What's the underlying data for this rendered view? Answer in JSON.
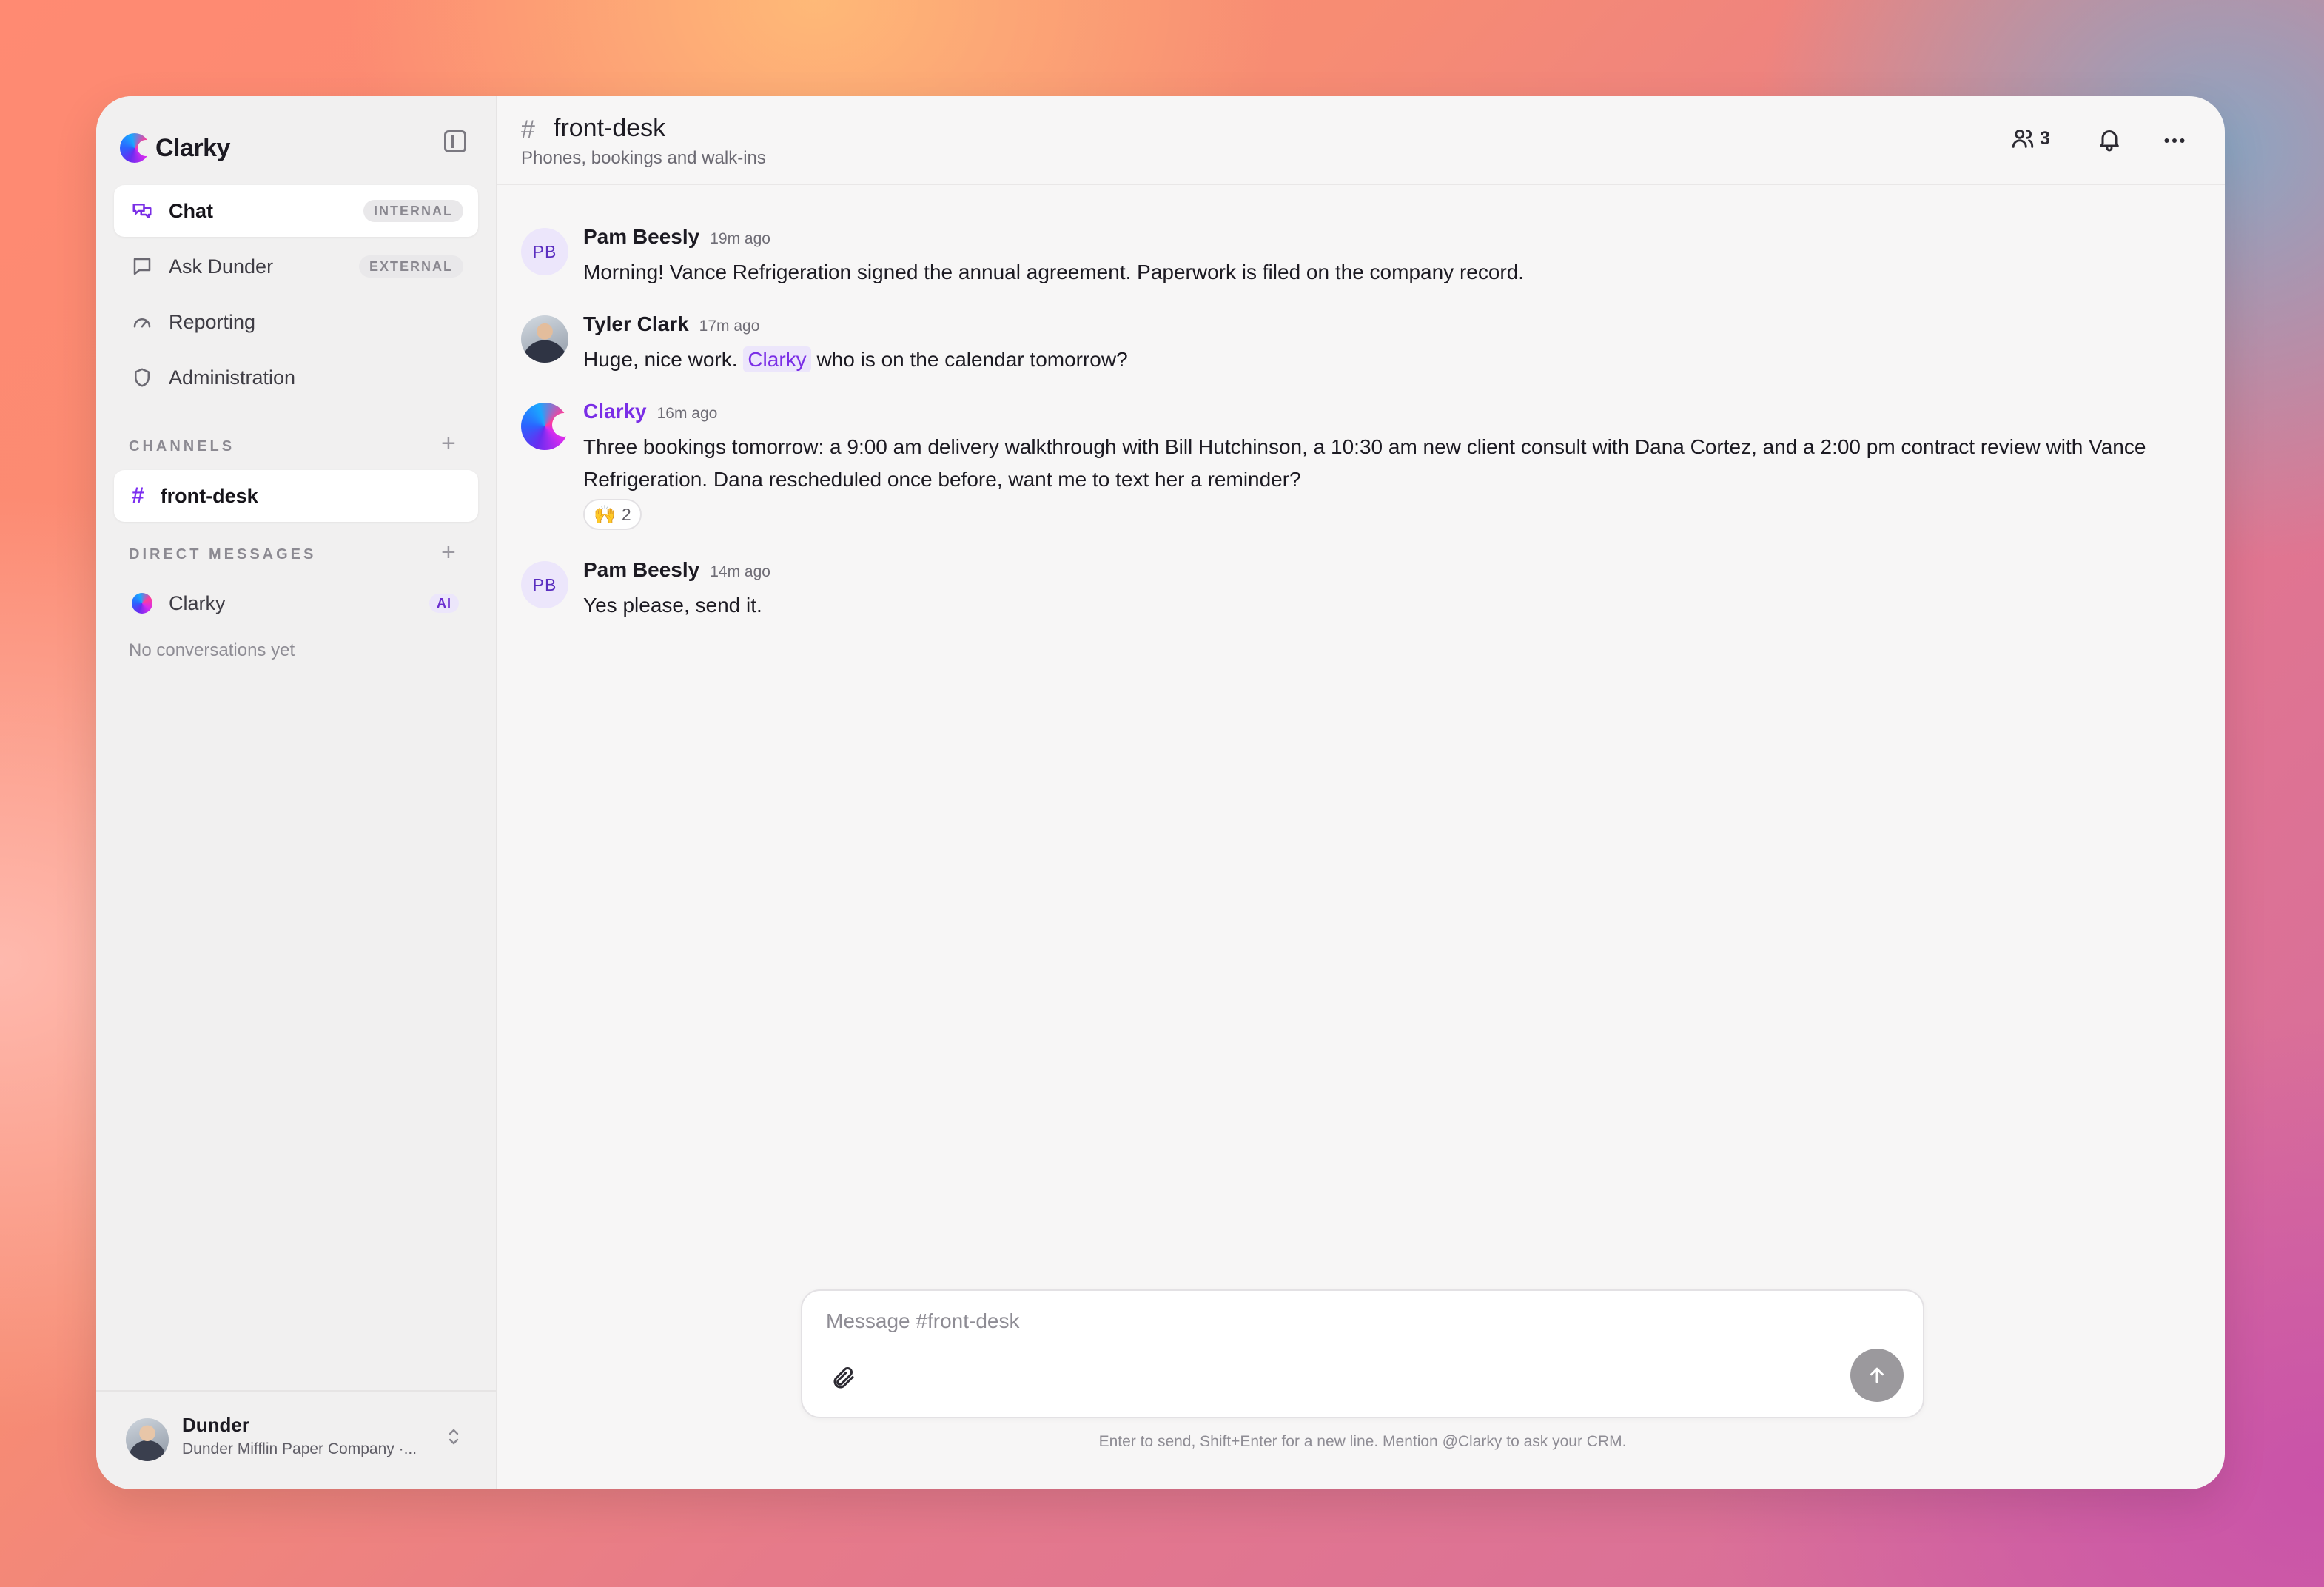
{
  "brand": {
    "name": "Clarky"
  },
  "nav": [
    {
      "label": "Chat",
      "badge": "INTERNAL"
    },
    {
      "label": "Ask Dunder",
      "badge": "EXTERNAL"
    },
    {
      "label": "Reporting"
    },
    {
      "label": "Administration"
    }
  ],
  "sections": {
    "channels": "CHANNELS",
    "direct_messages": "DIRECT MESSAGES"
  },
  "channels": [
    {
      "name": "front-desk"
    }
  ],
  "dms": [
    {
      "name": "Clarky",
      "badge": "AI"
    }
  ],
  "dm_empty": "No conversations yet",
  "account": {
    "name": "Dunder",
    "org": "Dunder Mifflin Paper Company ·..."
  },
  "header": {
    "hash": "#",
    "title": "front-desk",
    "subtitle": "Phones, bookings and walk-ins",
    "member_count": "3"
  },
  "messages": [
    {
      "initials": "PB",
      "author": "Pam Beesly",
      "time": "19m ago",
      "text": "Morning! Vance Refrigeration signed the annual agreement. Paperwork is filed on the company record."
    },
    {
      "author": "Tyler Clark",
      "time": "17m ago",
      "text_before": "Huge, nice work. ",
      "mention": "Clarky",
      "text_after": " who is on the calendar tomorrow?"
    },
    {
      "author": "Clarky",
      "time": "16m ago",
      "text": "Three bookings tomorrow: a 9:00 am delivery walkthrough with Bill Hutchinson, a 10:30 am new client consult with Dana Cortez, and a 2:00 pm contract review with Vance Refrigeration. Dana rescheduled once before, want me to text her a reminder?",
      "reaction": {
        "emoji": "🙌",
        "count": "2"
      }
    },
    {
      "initials": "PB",
      "author": "Pam Beesly",
      "time": "14m ago",
      "text": "Yes please, send it."
    }
  ],
  "composer": {
    "placeholder": "Message #front-desk",
    "hint": "Enter to send, Shift+Enter for a new line. Mention @Clarky to ask your CRM."
  },
  "colors": {
    "accent": "#7a2ee6",
    "send_button": "#9b999d"
  }
}
